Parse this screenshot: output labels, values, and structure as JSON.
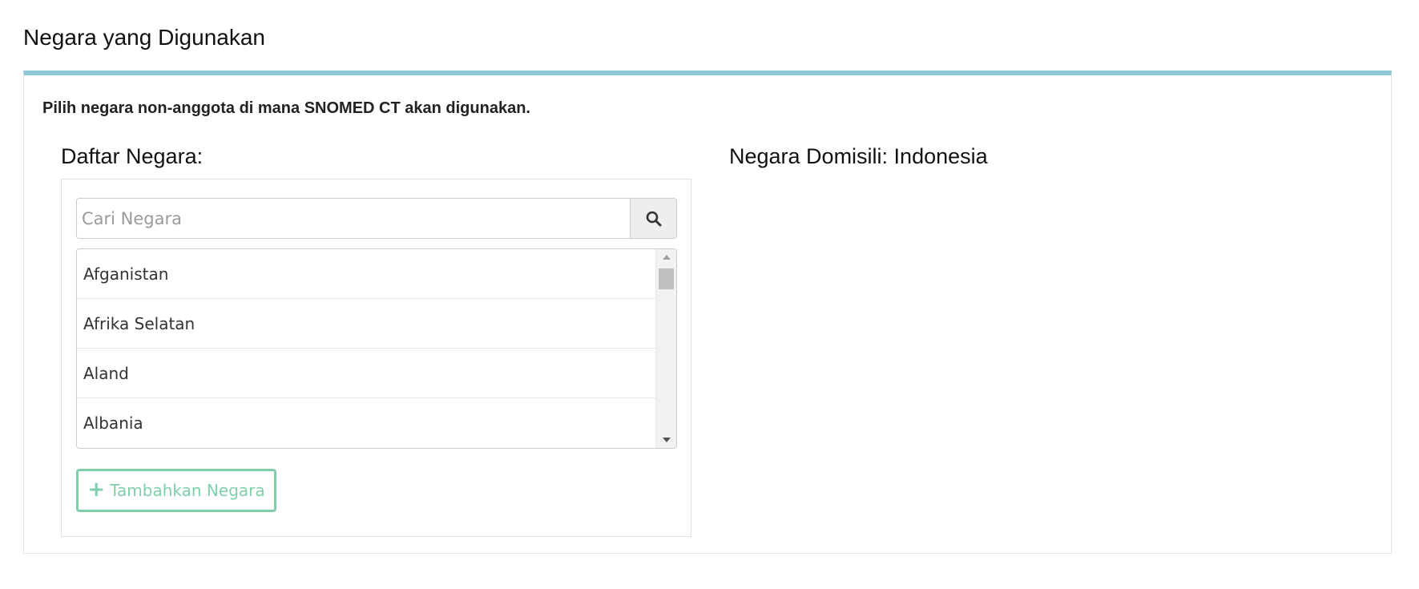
{
  "page": {
    "title": "Negara yang Digunakan"
  },
  "panel": {
    "instruction": "Pilih negara non-anggota di mana SNOMED CT akan digunakan.",
    "list_heading": "Daftar Negara:",
    "residence_label": "Negara Domisili: Indonesia"
  },
  "search": {
    "placeholder": "Cari Negara",
    "value": "",
    "button_icon": "search-icon"
  },
  "countries": [
    "Afganistan",
    "Afrika Selatan",
    "Aland",
    "Albania"
  ],
  "add_button": {
    "icon": "plus-icon",
    "label": "Tambahkan Negara"
  },
  "colors": {
    "panel_accent": "#8cc8d6",
    "add_button": "#7fd0a8"
  }
}
